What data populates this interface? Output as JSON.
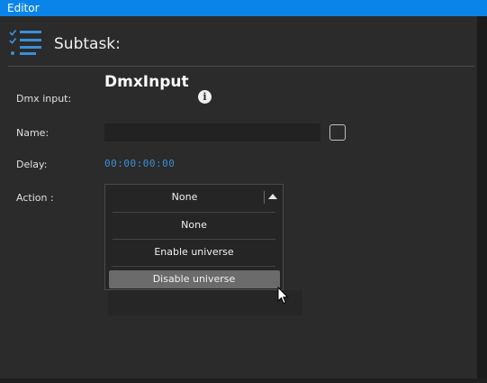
{
  "window": {
    "title": "Editor"
  },
  "header": {
    "title": "Subtask:",
    "icon": "task-list-icon"
  },
  "form": {
    "dmx_input_label": "Dmx input:",
    "dmx_input_value": "DmxInput",
    "info_icon": "i",
    "name_label": "Name:",
    "name_value": "",
    "delay_label": "Delay:",
    "delay_value": "00:00:00:00",
    "action_label": "Action :",
    "action_selected": "None",
    "action_options": [
      "None",
      "Enable universe",
      "Disable universe"
    ],
    "highlighted_option": "Disable universe"
  },
  "colors": {
    "titlebar": "#0a84e8",
    "accent": "#3a8fd6",
    "highlight": "#6b6b6b"
  }
}
